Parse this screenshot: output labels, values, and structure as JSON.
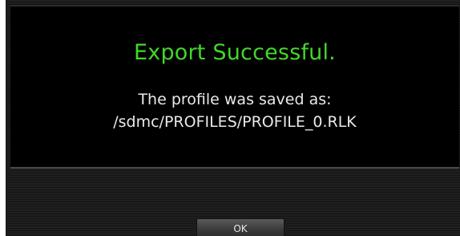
{
  "dialog": {
    "title": "Export Successful.",
    "message_line1": "The profile was saved as:",
    "message_line2": "/sdmc/PROFILES/PROFILE_0.RLK"
  },
  "buttons": {
    "ok_label": "OK"
  },
  "colors": {
    "title": "#44d62c",
    "background": "#000000",
    "text": "#e9e9e9"
  }
}
